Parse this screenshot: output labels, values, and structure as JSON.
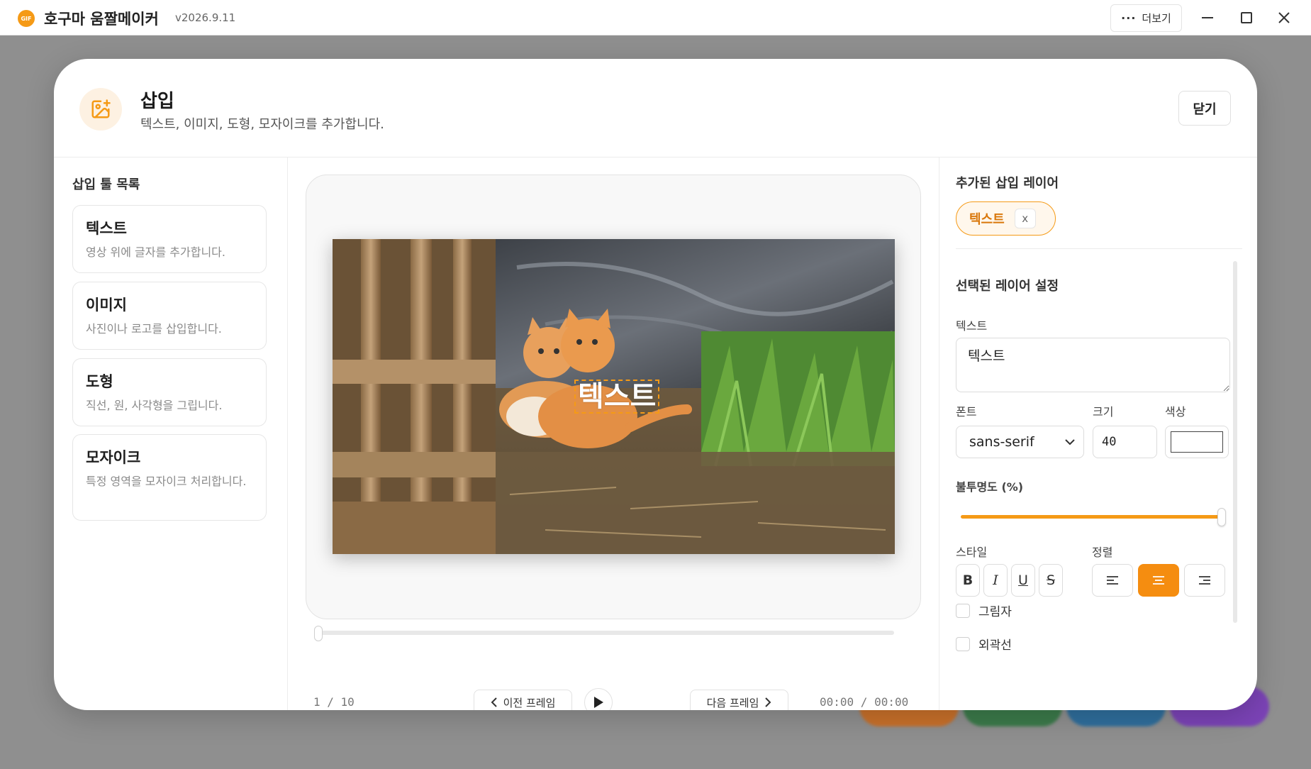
{
  "app": {
    "logo_text": "GIF",
    "title": "호구마 움짤메이커",
    "version": "v2026.9.11",
    "more_label": "더보기",
    "accent_color": "#f59a16"
  },
  "modal": {
    "title": "삽입",
    "subtitle": "텍스트, 이미지, 도형, 모자이크를 추가합니다.",
    "close_label": "닫기",
    "icon": "image-plus-icon"
  },
  "tools": {
    "heading": "삽입 툴 목록",
    "items": [
      {
        "title": "텍스트",
        "desc": "영상 위에 글자를 추가합니다."
      },
      {
        "title": "이미지",
        "desc": "사진이나 로고를 삽입합니다."
      },
      {
        "title": "도형",
        "desc": "직선, 원, 사각형을 그립니다."
      },
      {
        "title": "모자이크",
        "desc": "특정 영역을 모자이크 처리합니다."
      }
    ]
  },
  "preview": {
    "overlay_text": "텍스트",
    "frame_counter": "1 / 10",
    "prev_label": "이전 프레임",
    "next_label": "다음 프레임",
    "time": "00:00 / 00:00",
    "timeline_position": 0
  },
  "layers": {
    "heading": "추가된 삽입 레이어",
    "items": [
      {
        "label": "텍스트",
        "remove": "x"
      }
    ]
  },
  "settings": {
    "heading": "선택된 레이어 설정",
    "text_label": "텍스트",
    "text_value": "텍스트",
    "font_label": "폰트",
    "font_value": "sans-serif",
    "size_label": "크기",
    "size_value": "40",
    "color_label": "색상",
    "color_value": "#ffffff",
    "opacity_label": "불투명도 (%)",
    "opacity_value": 100,
    "style_label": "스타일",
    "style_buttons": [
      "B",
      "I",
      "U",
      "S"
    ],
    "align_label": "정렬",
    "align_options": [
      "left",
      "center",
      "right"
    ],
    "align_selected": "center",
    "shadow_label": "그림자",
    "outline_label": "외곽선"
  }
}
